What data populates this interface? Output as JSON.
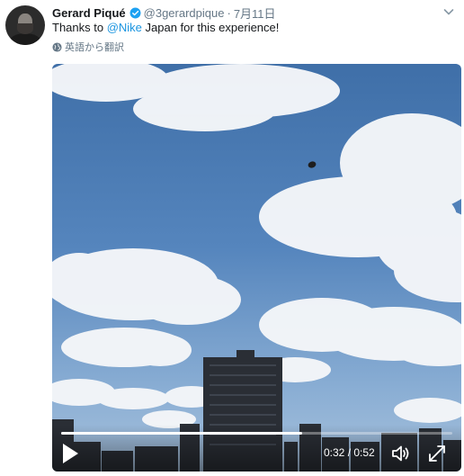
{
  "user": {
    "name": "Gerard Piqué",
    "handle": "@3gerardpique",
    "separator": "·",
    "date": "7月11日"
  },
  "tweet": {
    "text_before": "Thanks to ",
    "mention": "@Nike",
    "text_after": " Japan for this experience!"
  },
  "translate": {
    "label": "英語から翻訳",
    "icon": "globe-icon"
  },
  "video": {
    "current_time": "0:32",
    "duration": "0:52",
    "time_separator": " / ",
    "progress_fraction": 0.615,
    "play_icon": "play-icon",
    "volume_icon": "volume-icon",
    "fullscreen_icon": "fullscreen-icon"
  },
  "colors": {
    "link": "#1b95e0",
    "verified": "#1da1f2",
    "muted": "#657786"
  }
}
